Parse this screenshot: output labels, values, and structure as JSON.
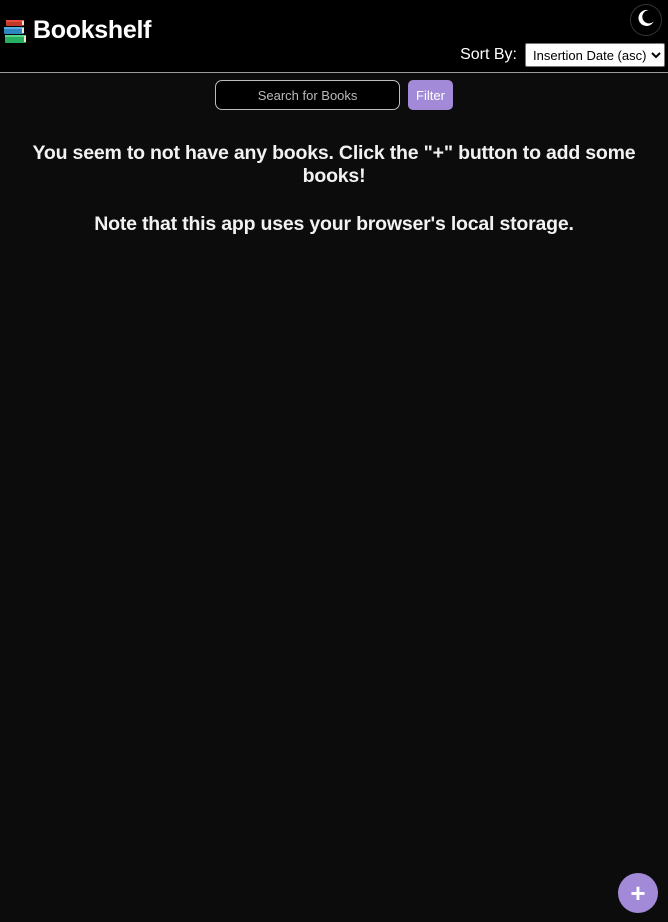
{
  "header": {
    "title": "Bookshelf",
    "logo_icon": "books-icon",
    "theme_toggle_icon": "moon-icon",
    "sort_label": "Sort By:",
    "sort_selected": "Insertion Date (asc)"
  },
  "search": {
    "placeholder": "Search for Books",
    "value": "",
    "filter_label": "Filter"
  },
  "main": {
    "empty_message": "You seem to not have any books. Click the \"+\" button to add some books!",
    "storage_note": "Note that this app uses your browser's local storage."
  },
  "fab": {
    "label": "+"
  },
  "colors": {
    "accent": "#a28ad8",
    "background": "#0c0c0c",
    "header_background": "#000000"
  }
}
